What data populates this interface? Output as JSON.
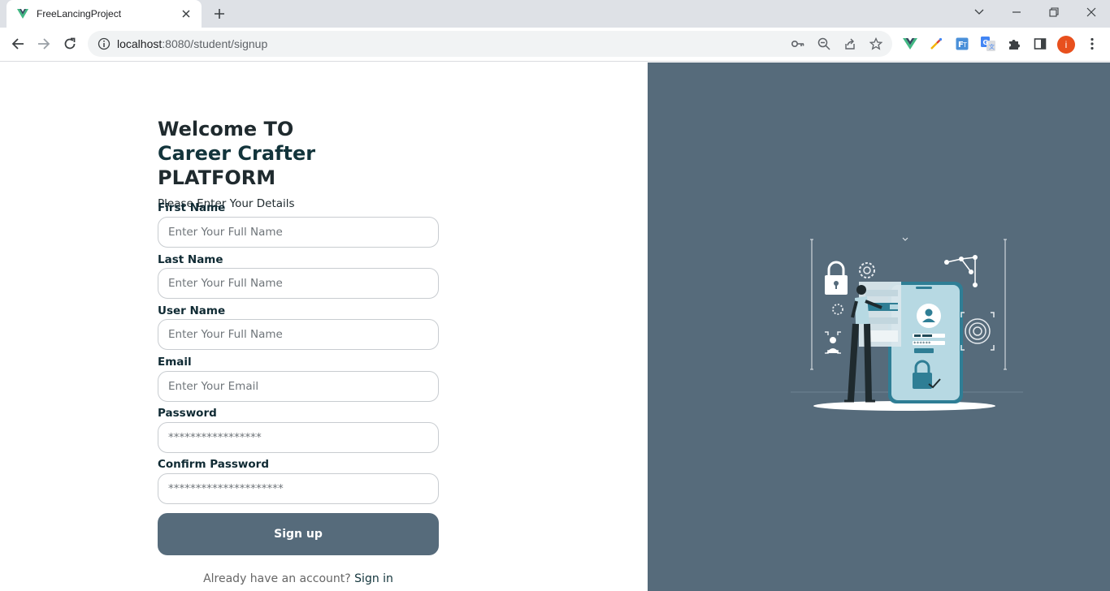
{
  "browser": {
    "tab_title": "FreeLancingProject",
    "url_host": "localhost",
    "url_path": ":8080/student/signup",
    "profile_initial": "i",
    "icons": [
      "vue-favicon",
      "close-icon",
      "plus-icon",
      "chevron-down-icon",
      "minimize-icon",
      "restore-icon",
      "window-close-icon",
      "back-icon",
      "forward-icon",
      "reload-icon",
      "info-icon",
      "key-icon",
      "zoom-icon",
      "share-icon",
      "star-icon",
      "vue-devtools-icon",
      "color-picker-icon",
      "translate-icon",
      "google-translate-icon",
      "puzzle-icon",
      "sidepanel-icon",
      "menu-dots-icon"
    ]
  },
  "page": {
    "welcome": "Welcome TO",
    "brand": "Career Crafter",
    "platform": "PLATFORM",
    "subtitle": "Please Enter Your Details",
    "fields": [
      {
        "label": "First Name",
        "placeholder": "Enter Your Full Name"
      },
      {
        "label": "Last Name",
        "placeholder": "Enter Your Full Name"
      },
      {
        "label": "User Name",
        "placeholder": "Enter Your Full Name"
      },
      {
        "label": "Email",
        "placeholder": "Enter Your Email"
      },
      {
        "label": "Password",
        "placeholder": "*****************"
      },
      {
        "label": "Confirm Password",
        "placeholder": "*********************"
      }
    ],
    "signup_label": "Sign up",
    "signin_prompt": "Already have an account?",
    "signin_link": "Sign in"
  },
  "colors": {
    "accent": "#566b7b",
    "brand_text": "#12343b"
  }
}
